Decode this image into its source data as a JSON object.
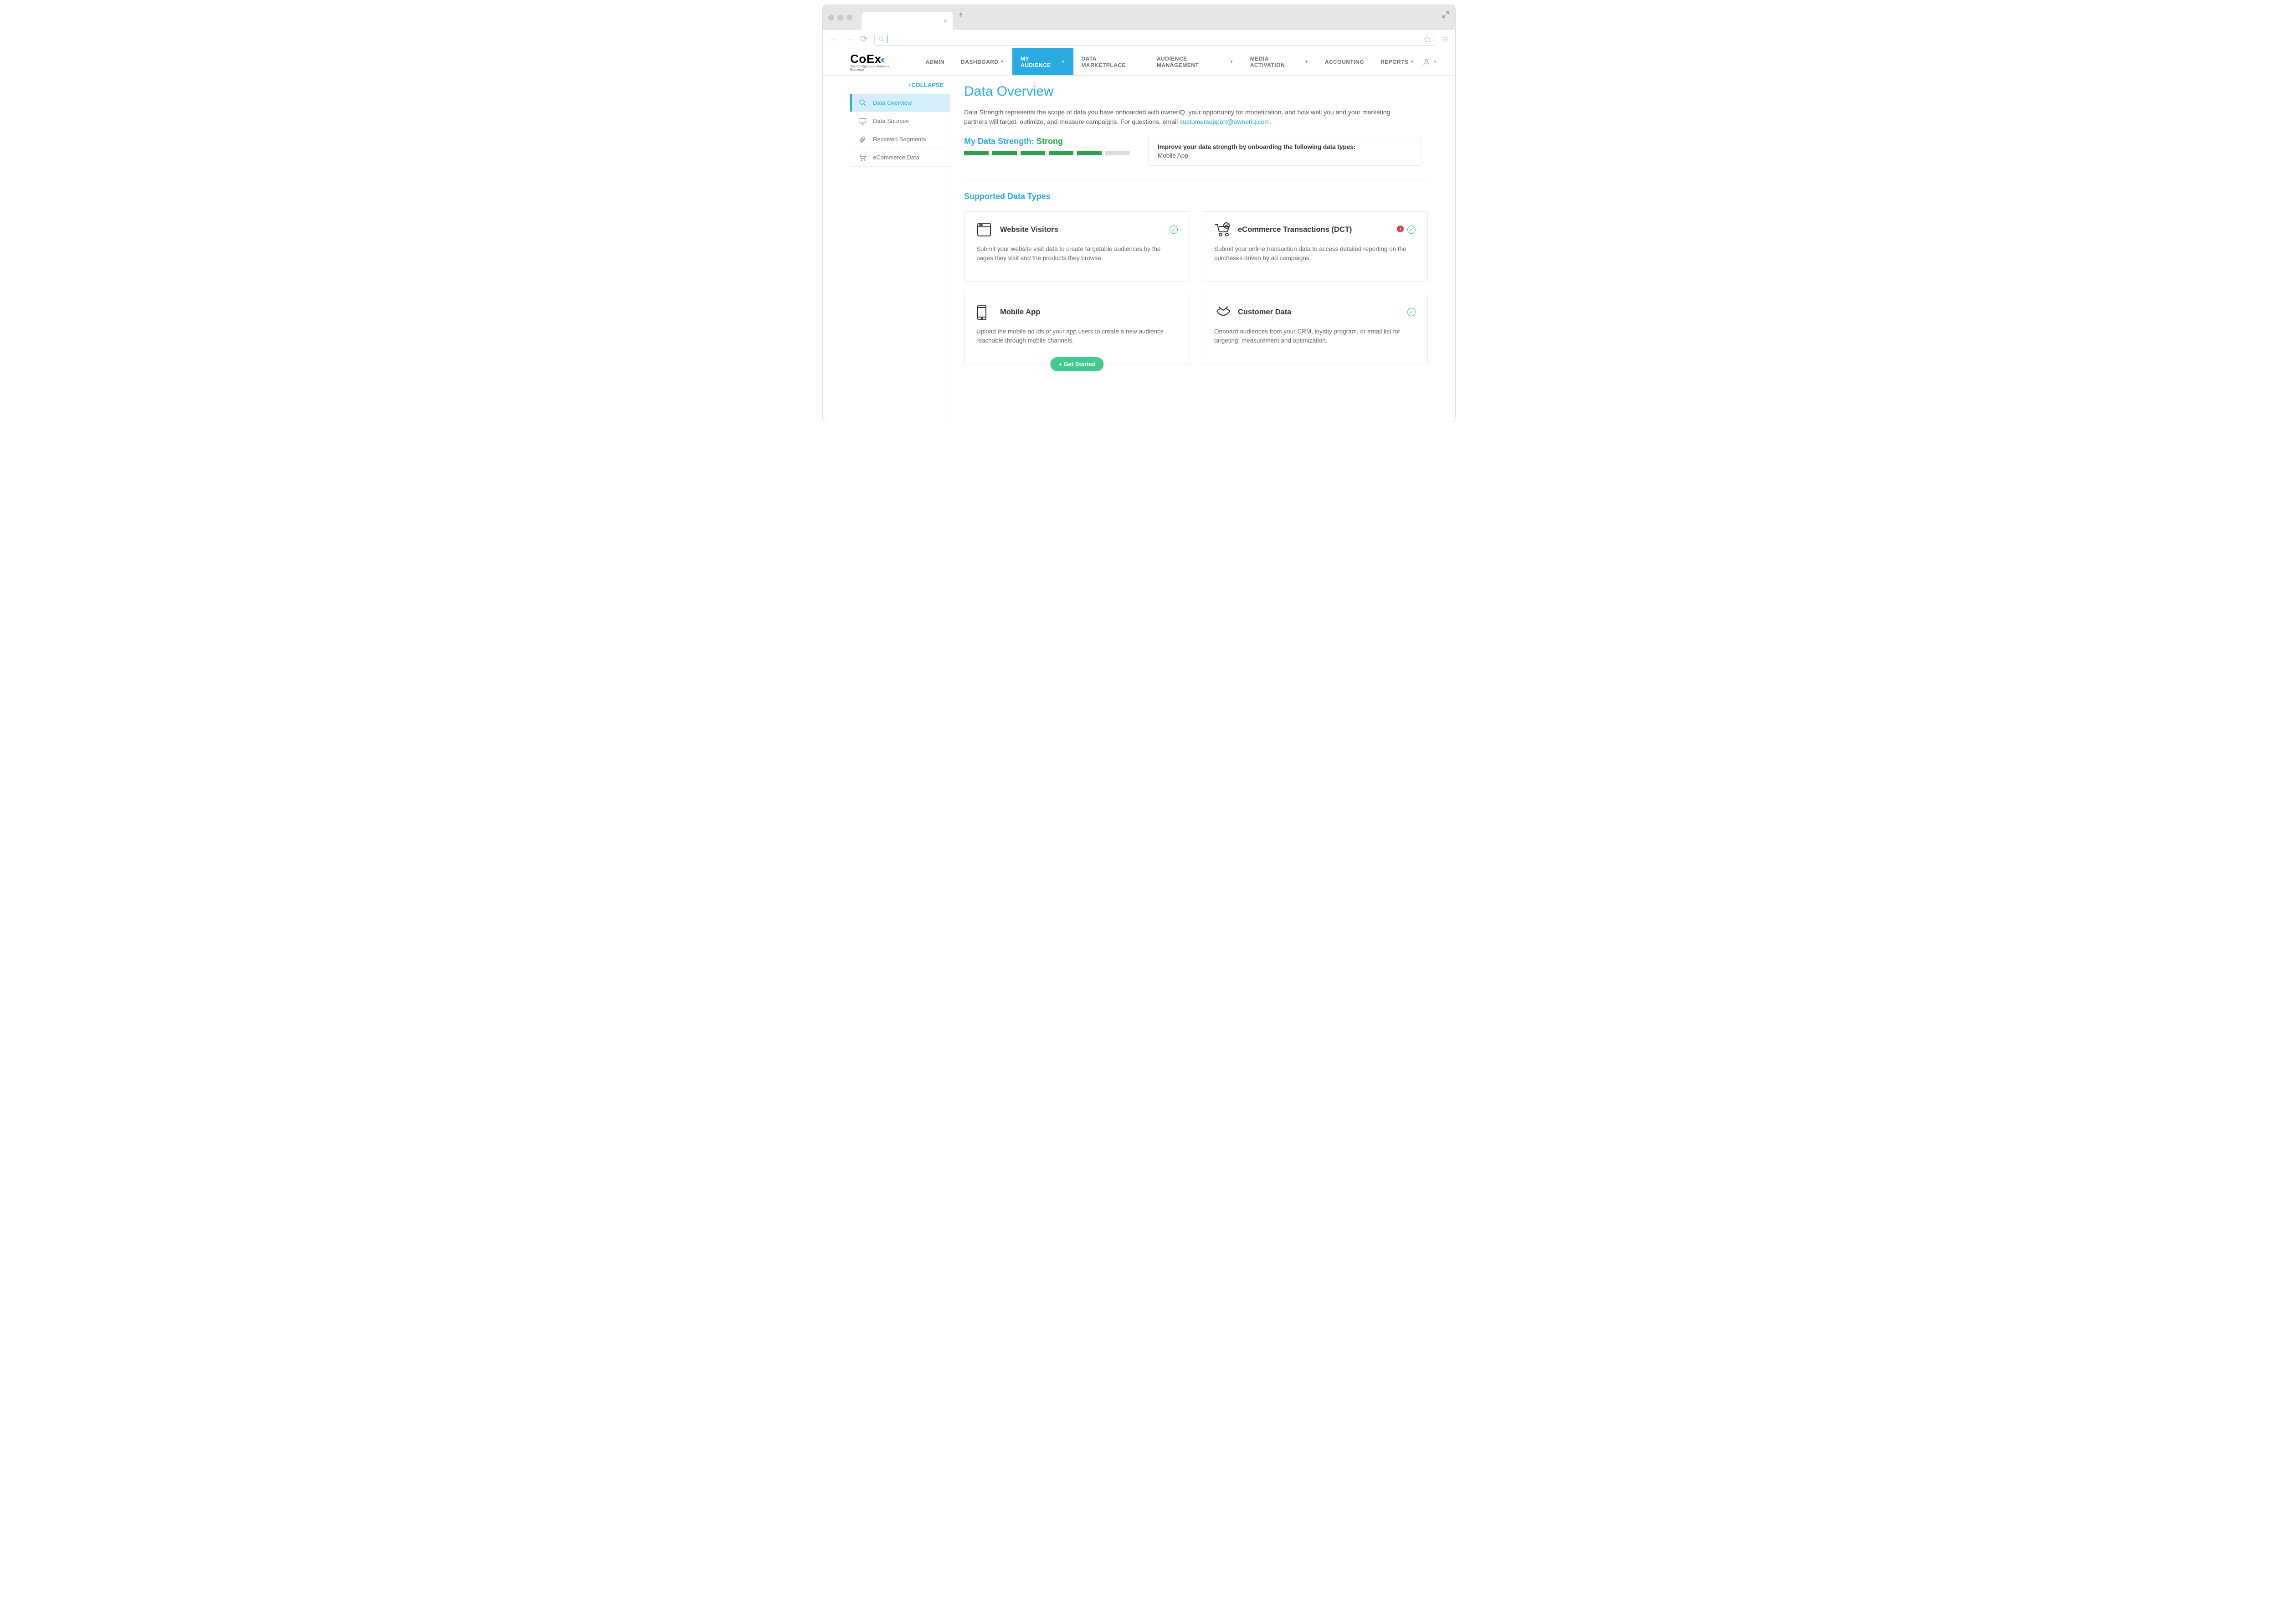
{
  "nav": {
    "items": [
      {
        "label": "ADMIN",
        "dropdown": false
      },
      {
        "label": "DASHBOARD",
        "dropdown": true
      },
      {
        "label": "MY AUDIENCE",
        "dropdown": true,
        "active": true
      },
      {
        "label": "DATA MARKETPLACE",
        "dropdown": false
      },
      {
        "label": "AUDIENCE MANAGEMENT",
        "dropdown": true
      },
      {
        "label": "MEDIA ACTIVATION",
        "dropdown": true
      },
      {
        "label": "ACCOUNTING",
        "dropdown": false
      },
      {
        "label": "REPORTS",
        "dropdown": true
      }
    ]
  },
  "logo": {
    "brand_co": "Co",
    "brand_e": "E",
    "brand_x": "x",
    "tagline": "The Co-Operative Audience Exchange"
  },
  "sidebar": {
    "collapse_label": "COLLAPSE",
    "items": [
      {
        "label": "Data Overview",
        "icon": "search"
      },
      {
        "label": "Data Sources",
        "icon": "monitor"
      },
      {
        "label": "Received Segments",
        "icon": "clip"
      },
      {
        "label": "eCommerce Data",
        "icon": "cart"
      }
    ]
  },
  "page": {
    "title": "Data Overview",
    "intro_a": "Data Strength represents the scope of data you have onboarded with ownerIQ, your opportunity for monetization, and how well you and your marketing partners will target, optimize, and measure campaigns. For questions, email ",
    "intro_link": "customersupport@owneriq.com",
    "intro_b": "."
  },
  "strength": {
    "label": "My Data Strength: ",
    "value": "Strong",
    "filled": 5,
    "total": 6,
    "improve_title": "Improve your data strength by onboarding the following data types:",
    "improve_value": "Mobile App"
  },
  "supported": {
    "heading": "Supported Data Types",
    "cards": [
      {
        "title": "Website Visitors",
        "desc": "Submit your website visit data to create targetable audiences by the pages they visit and the products they browse.",
        "ok": true,
        "alert": false
      },
      {
        "title": "eCommerce Transactions (DCT)",
        "desc": "Submit your online transaction data to access detailed reporting on the purchases driven by ad campaigns.",
        "ok": true,
        "alert": true
      },
      {
        "title": "Mobile App",
        "desc": "Upload the mobile ad ids of your app users to create a new audience reachable through mobile channels.",
        "ok": false,
        "alert": false,
        "cta": "+ Get Started"
      },
      {
        "title": "Customer Data",
        "desc": "Onboard audiences from your CRM, loyalty program, or email list for targeting, measurement and optimization.",
        "ok": true,
        "alert": false
      }
    ]
  }
}
